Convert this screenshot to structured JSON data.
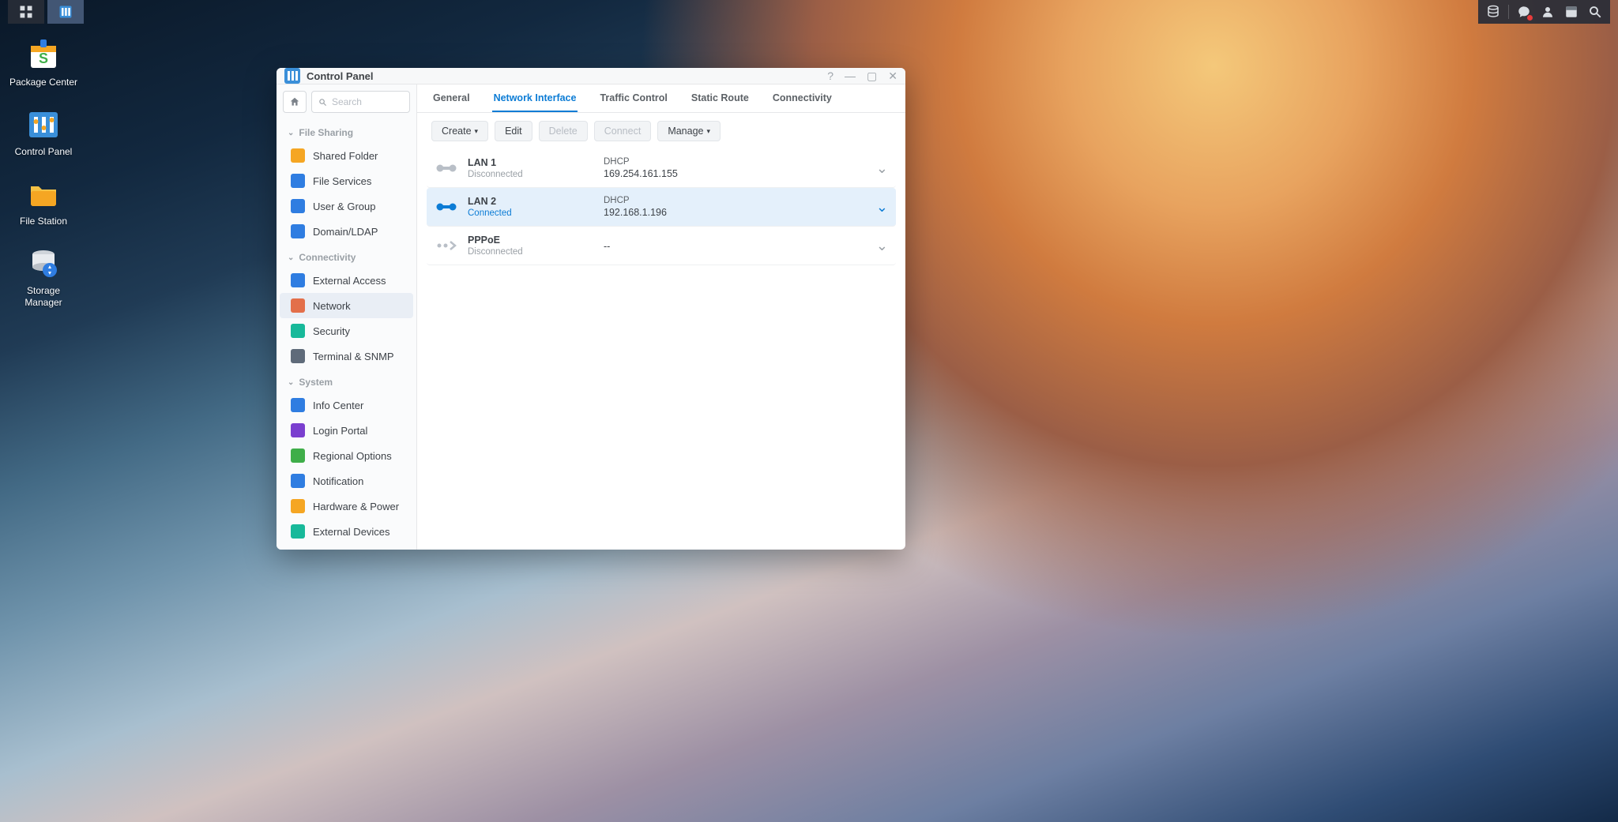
{
  "desktop_icons": [
    {
      "label": "Package Center"
    },
    {
      "label": "Control Panel"
    },
    {
      "label": "File Station"
    },
    {
      "label": "Storage Manager"
    }
  ],
  "window": {
    "title": "Control Panel",
    "search_placeholder": "Search"
  },
  "sidebar": {
    "sections": [
      {
        "label": "File Sharing",
        "items": [
          {
            "label": "Shared Folder",
            "color": "#f5a623"
          },
          {
            "label": "File Services",
            "color": "#2f7de1"
          },
          {
            "label": "User & Group",
            "color": "#2f7de1"
          },
          {
            "label": "Domain/LDAP",
            "color": "#2f7de1"
          }
        ]
      },
      {
        "label": "Connectivity",
        "items": [
          {
            "label": "External Access",
            "color": "#2f7de1"
          },
          {
            "label": "Network",
            "color": "#e36f4a",
            "selected": true
          },
          {
            "label": "Security",
            "color": "#18b99a"
          },
          {
            "label": "Terminal & SNMP",
            "color": "#5f6b7a"
          }
        ]
      },
      {
        "label": "System",
        "items": [
          {
            "label": "Info Center",
            "color": "#2f7de1"
          },
          {
            "label": "Login Portal",
            "color": "#7a3fcf"
          },
          {
            "label": "Regional Options",
            "color": "#3fae49"
          },
          {
            "label": "Notification",
            "color": "#2f7de1"
          },
          {
            "label": "Hardware & Power",
            "color": "#f5a623"
          },
          {
            "label": "External Devices",
            "color": "#18b99a"
          }
        ]
      }
    ]
  },
  "tabs": [
    {
      "label": "General"
    },
    {
      "label": "Network Interface",
      "active": true
    },
    {
      "label": "Traffic Control"
    },
    {
      "label": "Static Route"
    },
    {
      "label": "Connectivity"
    }
  ],
  "toolbar": {
    "create": "Create",
    "edit": "Edit",
    "delete": "Delete",
    "connect": "Connect",
    "manage": "Manage"
  },
  "interfaces": [
    {
      "name": "LAN 1",
      "status": "Disconnected",
      "connected": false,
      "mode": "DHCP",
      "addr": "169.254.161.155",
      "type": "lan"
    },
    {
      "name": "LAN 2",
      "status": "Connected",
      "connected": true,
      "mode": "DHCP",
      "addr": "192.168.1.196",
      "type": "lan",
      "selected": true
    },
    {
      "name": "PPPoE",
      "status": "Disconnected",
      "connected": false,
      "mode": "",
      "addr": "--",
      "type": "pppoe"
    }
  ]
}
